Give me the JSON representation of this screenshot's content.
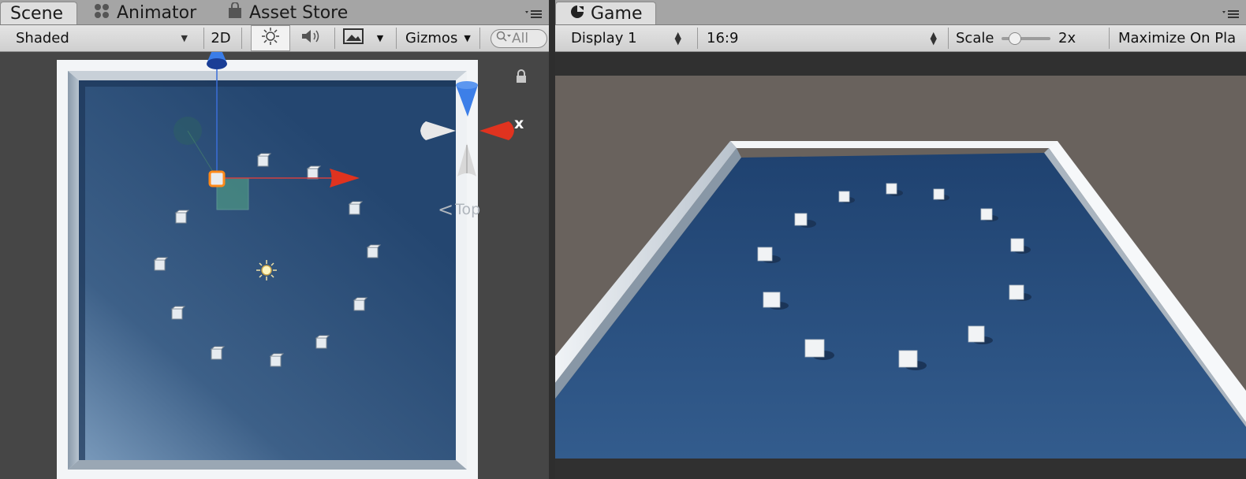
{
  "scene_tabs": [
    {
      "label": "Scene",
      "active": true,
      "icon": "none"
    },
    {
      "label": "Animator",
      "active": false,
      "icon": "animator-icon"
    },
    {
      "label": "Asset Store",
      "active": false,
      "icon": "asset-store-icon"
    }
  ],
  "scene_toolbar": {
    "shading_mode": "Shaded",
    "mode_2d": "2D",
    "gizmos": "Gizmos",
    "search_placeholder": "All"
  },
  "scene_view": {
    "gizmo_axis_label": "x",
    "orientation_label": "Top",
    "background_color": "#464646",
    "floor_color": "#2a4a72",
    "wall_color": "#c9d2dc"
  },
  "game_tabs": [
    {
      "label": "Game",
      "active": true,
      "icon": "game-icon"
    }
  ],
  "game_toolbar": {
    "display": "Display 1",
    "aspect": "16:9",
    "scale_label": "Scale",
    "scale_value": "2x",
    "scale_fraction": 0.2,
    "maximize": "Maximize On Pla"
  },
  "game_view": {
    "sky_color": "#68625d",
    "floor_color": "#2d5585"
  }
}
